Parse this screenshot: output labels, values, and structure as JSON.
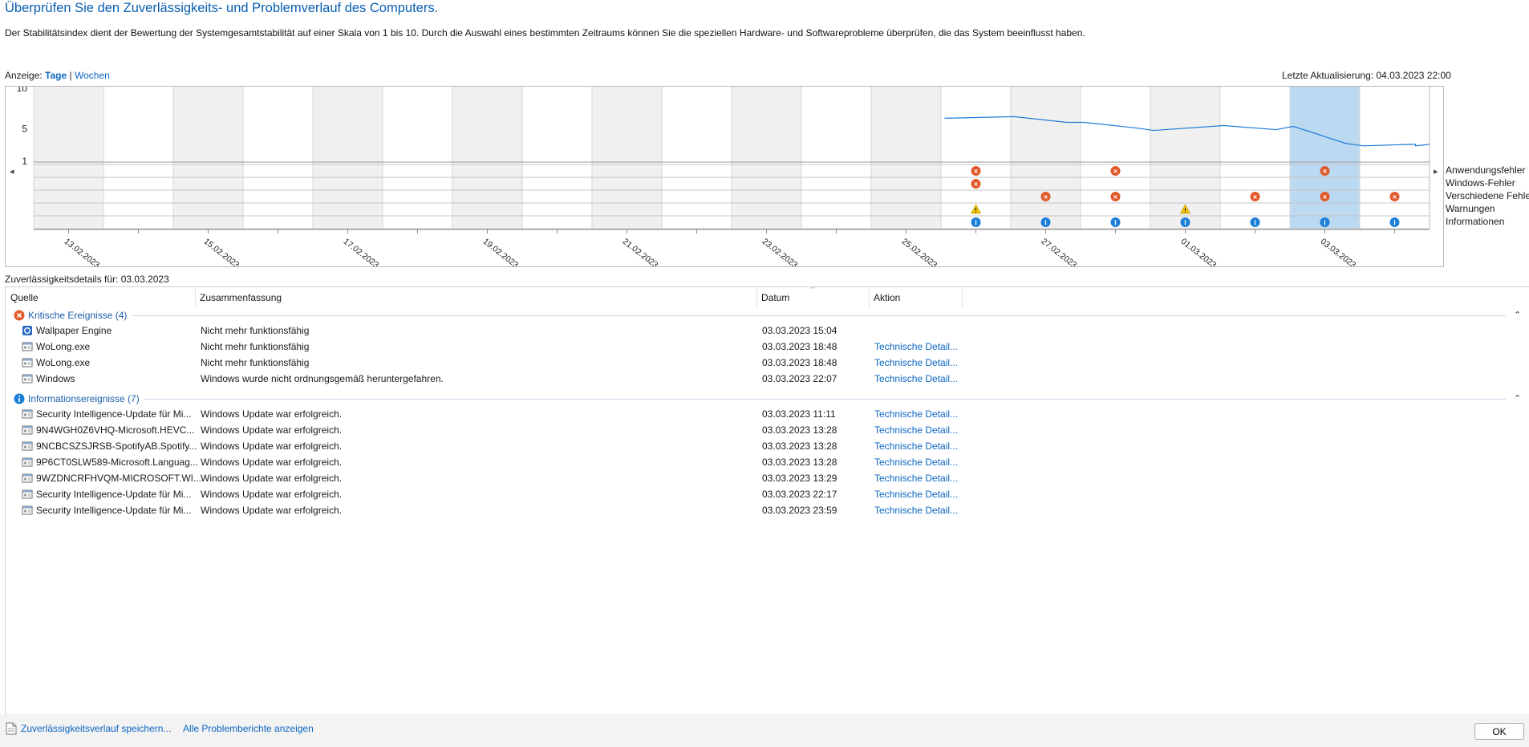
{
  "header": {
    "title": "Überprüfen Sie den Zuverlässigkeits- und Problemverlauf des Computers.",
    "description": "Der Stabilitätsindex dient der Bewertung der Systemgesamtstabilität auf einer Skala von 1 bis 10. Durch die Auswahl eines bestimmten Zeitraums können Sie die speziellen Hardware- und Softwareprobleme überprüfen, die das System beeinflusst haben."
  },
  "view": {
    "label": "Anzeige:",
    "days": "Tage",
    "separator": "|",
    "weeks": "Wochen"
  },
  "last_update": "Letzte Aktualisierung: 04.03.2023 22:00",
  "chart": {
    "y_ticks": [
      "10",
      "5",
      "1"
    ],
    "date_labels": [
      "13.02.2023",
      "15.02.2023",
      "17.02.2023",
      "19.02.2023",
      "21.02.2023",
      "23.02.2023",
      "25.02.2023",
      "27.02.2023",
      "01.03.2023",
      "03.03.2023"
    ],
    "row_labels": [
      "Anwendungsfehler",
      "Windows-Fehler",
      "Verschiedene Fehler",
      "Warnungen",
      "Informationen"
    ],
    "nav_left": "◂",
    "nav_right": "▸",
    "selected_day": "03.03.2023",
    "colors": {
      "line": "#1f7bd6",
      "selection": "#bcd9f2",
      "shade": "#f0f0f0",
      "error": "#e05a2b",
      "warning": "#f2c300",
      "info": "#1b7ed8"
    }
  },
  "chart_data": {
    "type": "line",
    "title": "",
    "x": [
      "26.02.2023",
      "27.02.2023",
      "27.02.2023",
      "28.02.2023",
      "28.02.2023",
      "01.03.2023",
      "02.03.2023",
      "02.03.2023",
      "03.03.2023",
      "03.03.2023",
      "04.03.2023",
      "04.03.2023",
      "04.03.2023"
    ],
    "y": [
      6.3,
      6.5,
      5.8,
      5.8,
      5.1,
      4.8,
      5.4,
      4.9,
      5.3,
      3.2,
      2.9,
      3.1,
      2.9
    ],
    "ylim": [
      1,
      10
    ],
    "y_ticks": [
      1,
      5,
      10
    ],
    "events": {
      "columns": [
        "13.02.2023",
        "14.02.2023",
        "15.02.2023",
        "16.02.2023",
        "17.02.2023",
        "18.02.2023",
        "19.02.2023",
        "20.02.2023",
        "21.02.2023",
        "22.02.2023",
        "23.02.2023",
        "24.02.2023",
        "25.02.2023",
        "26.02.2023",
        "27.02.2023",
        "28.02.2023",
        "01.03.2023",
        "02.03.2023",
        "03.03.2023",
        "04.03.2023"
      ],
      "Anwendungsfehler": [
        "26.02.2023",
        "28.02.2023",
        "03.03.2023"
      ],
      "Windows-Fehler": [
        "26.02.2023"
      ],
      "Verschiedene Fehler": [
        "27.02.2023",
        "28.02.2023",
        "02.03.2023",
        "03.03.2023",
        "04.03.2023"
      ],
      "Warnungen": [
        "26.02.2023",
        "01.03.2023"
      ],
      "Informationen": [
        "26.02.2023",
        "27.02.2023",
        "28.02.2023",
        "01.03.2023",
        "02.03.2023",
        "03.03.2023",
        "04.03.2023"
      ]
    }
  },
  "details": {
    "label": "Zuverlässigkeitsdetails für: 03.03.2023",
    "columns": [
      "Quelle",
      "Zusammenfassung",
      "Datum",
      "Aktion"
    ],
    "groups": [
      {
        "title": "Kritische Ereignisse (4)",
        "icon": "error-icon",
        "rows": [
          {
            "source": "Wallpaper Engine",
            "summary": "Nicht mehr funktionsfähig",
            "date": "03.03.2023 15:04",
            "action": ""
          },
          {
            "source": "WoLong.exe",
            "summary": "Nicht mehr funktionsfähig",
            "date": "03.03.2023 18:48",
            "action": "Technische Detail..."
          },
          {
            "source": "WoLong.exe",
            "summary": "Nicht mehr funktionsfähig",
            "date": "03.03.2023 18:48",
            "action": "Technische Detail..."
          },
          {
            "source": "Windows",
            "summary": "Windows wurde nicht ordnungsgemäß heruntergefahren.",
            "date": "03.03.2023 22:07",
            "action": "Technische Detail..."
          }
        ]
      },
      {
        "title": "Informationsereignisse (7)",
        "icon": "info-icon",
        "rows": [
          {
            "source": "Security Intelligence-Update für Mi...",
            "summary": "Windows Update war erfolgreich.",
            "date": "03.03.2023 11:11",
            "action": "Technische Detail..."
          },
          {
            "source": "9N4WGH0Z6VHQ-Microsoft.HEVC...",
            "summary": "Windows Update war erfolgreich.",
            "date": "03.03.2023 13:28",
            "action": "Technische Detail..."
          },
          {
            "source": "9NCBCSZSJRSB-SpotifyAB.Spotify...",
            "summary": "Windows Update war erfolgreich.",
            "date": "03.03.2023 13:28",
            "action": "Technische Detail..."
          },
          {
            "source": "9P6CT0SLW589-Microsoft.Languag...",
            "summary": "Windows Update war erfolgreich.",
            "date": "03.03.2023 13:28",
            "action": "Technische Detail..."
          },
          {
            "source": "9WZDNCRFHVQM-MICROSOFT.WI...",
            "summary": "Windows Update war erfolgreich.",
            "date": "03.03.2023 13:29",
            "action": "Technische Detail..."
          },
          {
            "source": "Security Intelligence-Update für Mi...",
            "summary": "Windows Update war erfolgreich.",
            "date": "03.03.2023 22:17",
            "action": "Technische Detail..."
          },
          {
            "source": "Security Intelligence-Update für Mi...",
            "summary": "Windows Update war erfolgreich.",
            "date": "03.03.2023 23:59",
            "action": "Technische Detail..."
          }
        ]
      }
    ]
  },
  "footer": {
    "save_link": "Zuverlässigkeitsverlauf speichern...",
    "reports_link": "Alle Problemberichte anzeigen",
    "ok_label": "OK"
  }
}
